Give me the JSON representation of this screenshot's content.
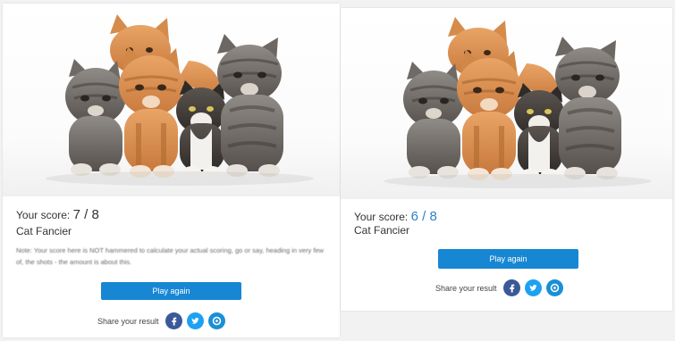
{
  "results": [
    {
      "image_alt": "Five kittens",
      "score_label": "Your score:",
      "score_value": "7 / 8",
      "rank": "Cat Fancier",
      "note": "Note: Your score here is NOT hammered to calculate your actual scoring, go or say, heading in very few of, the shots - the amount is about this.",
      "play_label": "Play again",
      "share_label": "Share your result"
    },
    {
      "image_alt": "Five kittens",
      "score_label": "Your score:",
      "score_value": "6 / 8",
      "rank": "Cat Fancier",
      "play_label": "Play again",
      "share_label": "Share your result"
    }
  ],
  "social": [
    {
      "name": "facebook-icon",
      "color": "#3b5998"
    },
    {
      "name": "twitter-icon",
      "color": "#1da1f2"
    },
    {
      "name": "email-icon",
      "color": "#1a8fd6"
    }
  ]
}
